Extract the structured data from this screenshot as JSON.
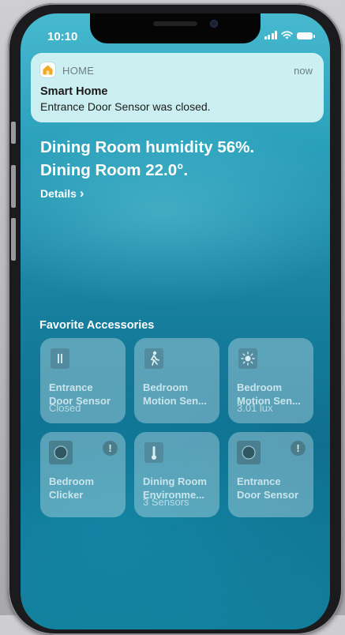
{
  "status_bar": {
    "time": "10:10"
  },
  "notification": {
    "app_name": "HOME",
    "time": "now",
    "title": "Smart Home",
    "body": "Entrance Door Sensor was closed."
  },
  "headline": {
    "line1": "Dining Room humidity 56%.",
    "line2": "Dining Room 22.0°."
  },
  "details": {
    "label": "Details",
    "chevron": "›"
  },
  "favorites": {
    "title": "Favorite Accessories",
    "tiles": [
      {
        "name": "Entrance\nDoor Sensor",
        "status": "Closed",
        "icon": "door-sensor-icon",
        "alert": false
      },
      {
        "name": "Bedroom\nMotion Sen...",
        "status": "",
        "icon": "motion-icon",
        "alert": false
      },
      {
        "name": "Bedroom\nMotion Sen...",
        "status": "3.01 lux",
        "icon": "light-sensor-icon",
        "alert": false
      },
      {
        "name": "Bedroom\nClicker",
        "status": "",
        "icon": "button-icon",
        "alert": true
      },
      {
        "name": "Dining Room\nEnvironme...",
        "status": "3 Sensors",
        "icon": "thermometer-icon",
        "alert": false
      },
      {
        "name": "Entrance\nDoor Sensor",
        "status": "",
        "icon": "button-icon",
        "alert": true
      }
    ],
    "alert_glyph": "!"
  },
  "colors": {
    "screen_top": "#46b9cf",
    "screen_bottom": "#0f6f8f",
    "notification_bg": "#d7f4f4",
    "home_icon": "#f5a623"
  }
}
